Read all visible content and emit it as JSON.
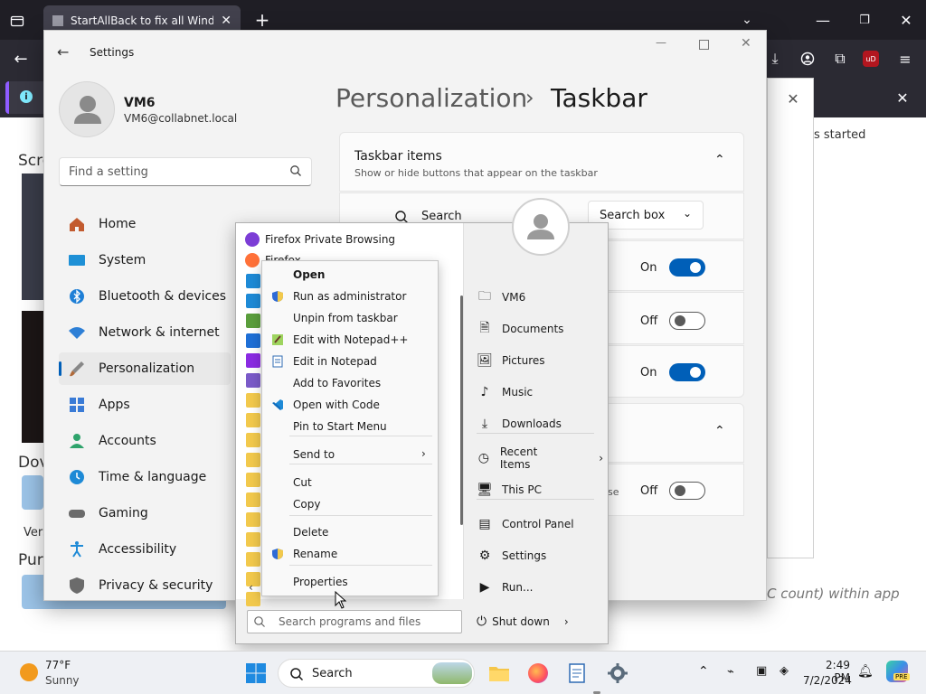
{
  "browser": {
    "tab_title": "StartAllBack to fix all Windows",
    "notif_text_end": "..."
  },
  "webpage": {
    "left_text_1": "Scre",
    "left_text_2": "Dov",
    "left_text_3": "Vers",
    "left_text_4": "Pur",
    "right_text_1": "s started",
    "right_text_2": "C count) within app"
  },
  "settings": {
    "title": "Settings",
    "user_name": "VM6",
    "user_email": "VM6@collabnet.local",
    "search_placeholder": "Find a setting",
    "breadcrumb_parent": "Personalization",
    "breadcrumb_sep": "›",
    "breadcrumb_current": "Taskbar",
    "nav": [
      {
        "label": "Home",
        "icon": "home-icon",
        "color": "#c25b2f"
      },
      {
        "label": "System",
        "icon": "system-icon",
        "color": "#1e90d6"
      },
      {
        "label": "Bluetooth & devices",
        "icon": "bluetooth-icon",
        "color": "#1e7fd6"
      },
      {
        "label": "Network & internet",
        "icon": "wifi-icon",
        "color": "#2d7fd6"
      },
      {
        "label": "Personalization",
        "icon": "brush-icon",
        "color": "#b06a3a"
      },
      {
        "label": "Apps",
        "icon": "apps-icon",
        "color": "#3a7bd6"
      },
      {
        "label": "Accounts",
        "icon": "accounts-icon",
        "color": "#2ea36b"
      },
      {
        "label": "Time & language",
        "icon": "clock-globe-icon",
        "color": "#1e8ad6"
      },
      {
        "label": "Gaming",
        "icon": "gamepad-icon",
        "color": "#6b6b6b"
      },
      {
        "label": "Accessibility",
        "icon": "accessibility-icon",
        "color": "#1e8ad6"
      },
      {
        "label": "Privacy & security",
        "icon": "shield-icon",
        "color": "#6b6b6b"
      }
    ],
    "taskbar_items": {
      "title": "Taskbar items",
      "subtitle": "Show or hide buttons that appear on the taskbar",
      "search_label": "Search",
      "search_value": "Search box",
      "rows": [
        {
          "state": "On"
        },
        {
          "state": "Off"
        },
        {
          "state": "On"
        }
      ],
      "partial_row_text": "se",
      "partial_row_state": "Off"
    }
  },
  "startmenu": {
    "pinned": [
      {
        "label": "Firefox Private Browsing",
        "icon": "firefox-private-icon"
      },
      {
        "label": "Firefox",
        "icon": "firefox-icon"
      }
    ],
    "right_links": [
      {
        "label": "VM6",
        "icon": "user-folder-icon"
      },
      {
        "label": "Documents",
        "icon": "document-icon"
      },
      {
        "label": "Pictures",
        "icon": "picture-icon"
      },
      {
        "label": "Music",
        "icon": "music-icon"
      },
      {
        "label": "Downloads",
        "icon": "download-icon"
      },
      {
        "label": "Recent Items",
        "icon": "clock-icon"
      },
      {
        "label": "This PC",
        "icon": "pc-icon"
      },
      {
        "label": "Control Panel",
        "icon": "control-panel-icon"
      },
      {
        "label": "Settings",
        "icon": "gear-icon"
      },
      {
        "label": "Run...",
        "icon": "run-icon"
      }
    ],
    "search_placeholder": "Search programs and files",
    "shutdown_label": "Shut down"
  },
  "context_menu": {
    "items": [
      {
        "label": "Open",
        "bold": true
      },
      {
        "label": "Run as administrator",
        "icon": "uac-shield-icon"
      },
      {
        "label": "Unpin from taskbar"
      },
      {
        "label": "Edit with Notepad++",
        "icon": "notepadpp-icon"
      },
      {
        "label": "Edit in Notepad",
        "icon": "notepad-icon"
      },
      {
        "label": "Add to Favorites"
      },
      {
        "label": "Open with Code",
        "icon": "vscode-icon"
      },
      {
        "label": "Pin to Start Menu"
      },
      {
        "label": "Send to",
        "submenu": true
      },
      {
        "label": "Cut"
      },
      {
        "label": "Copy"
      },
      {
        "label": "Delete"
      },
      {
        "label": "Rename",
        "icon": "uac-shield-icon"
      },
      {
        "label": "Properties"
      }
    ]
  },
  "taskbar": {
    "weather_temp": "77°F",
    "weather_desc": "Sunny",
    "search_label": "Search",
    "time": "2:49 PM",
    "date": "7/2/2024",
    "copilot_badge": "PRE"
  },
  "colors": {
    "accent": "#005fb8",
    "browser_dark": "#1f1e25",
    "taskbar_bg": "#eef0f4"
  }
}
